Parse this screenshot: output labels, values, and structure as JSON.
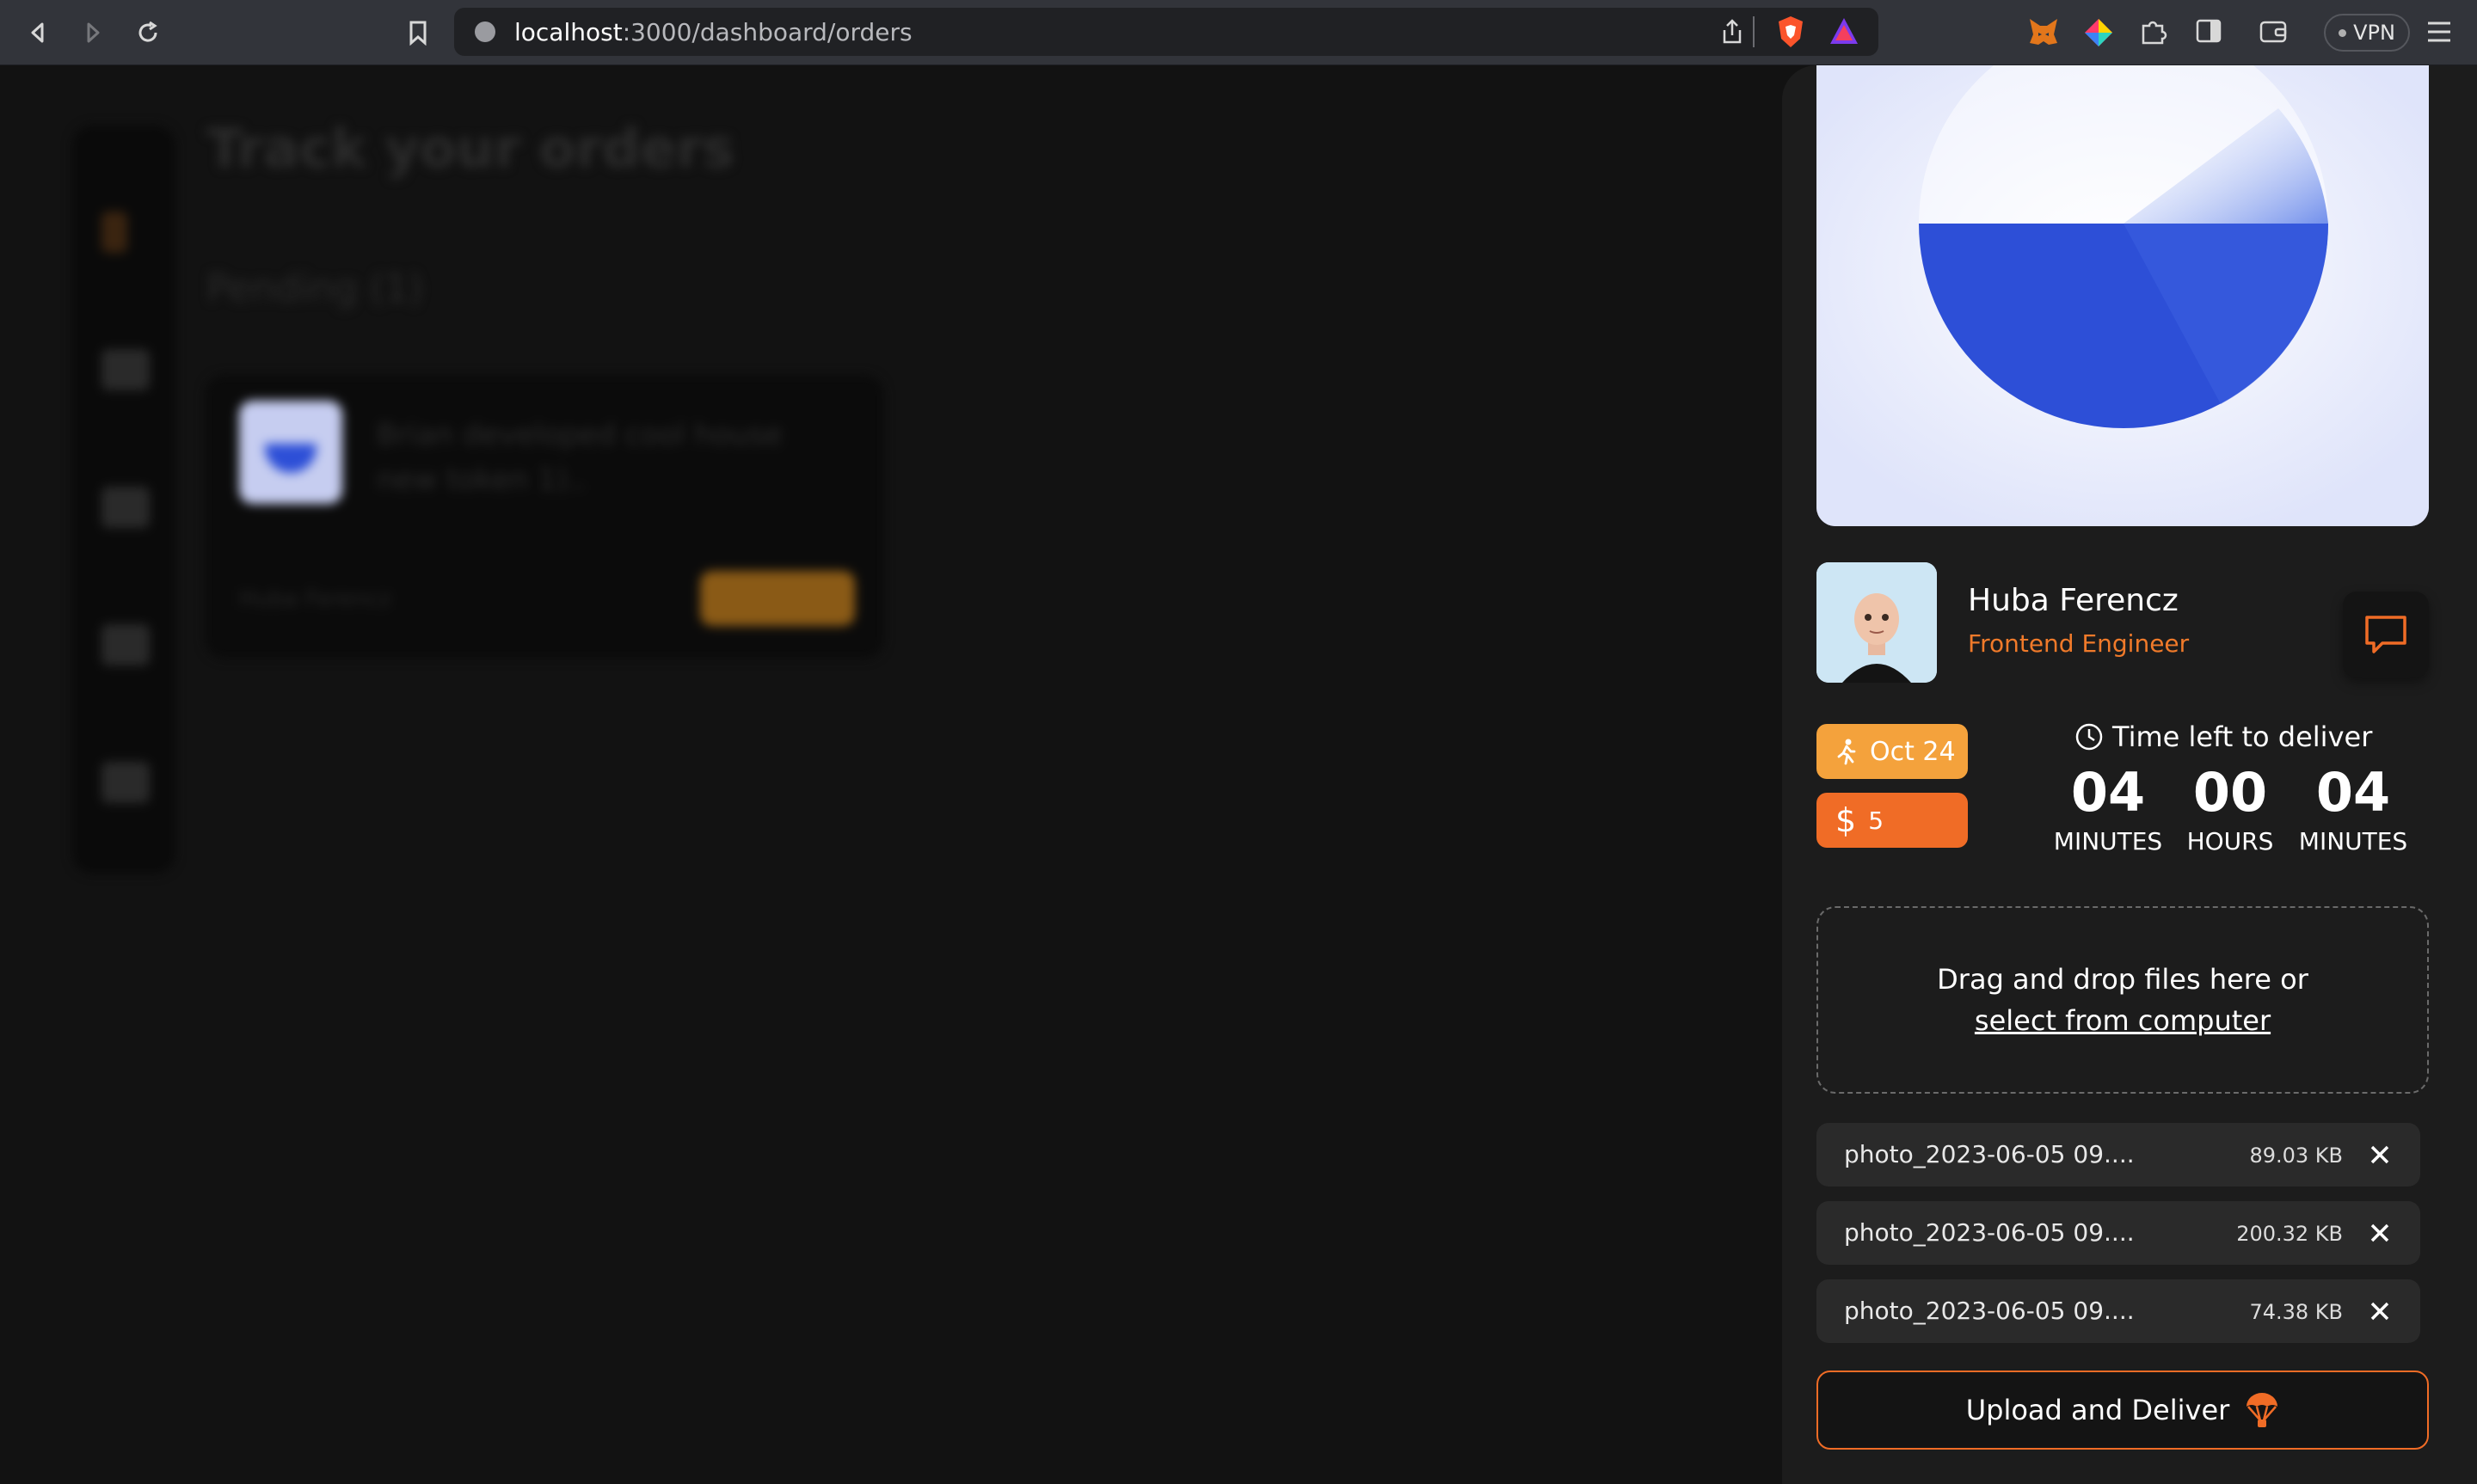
{
  "browser": {
    "url_host": "localhost",
    "url_path": ":3000/dashboard/orders",
    "vpn_label": "VPN",
    "icons": [
      "back-icon",
      "forward-icon",
      "reload-icon",
      "bookmark-icon",
      "share-icon",
      "brave-shield-icon",
      "brave-rewards-icon",
      "metamask-icon",
      "color-extension-icon",
      "extensions-icon",
      "sidebar-icon",
      "wallet-icon",
      "menu-icon"
    ]
  },
  "background": {
    "page_title": "Track your orders",
    "pending_heading": "Pending (1)",
    "card_text": "Brian developed cool house new token 1)..",
    "card_person": "Huba Ferencz"
  },
  "drawer": {
    "seller": {
      "name": "Huba Ferencz",
      "role": "Frontend Engineer"
    },
    "badges": {
      "date": "Oct 24",
      "price_symbol": "$",
      "price": "5"
    },
    "timer": {
      "title": "Time left to deliver",
      "blocks": [
        {
          "value": "04",
          "unit": "MINUTES"
        },
        {
          "value": "00",
          "unit": "HOURS"
        },
        {
          "value": "04",
          "unit": "MINUTES"
        }
      ]
    },
    "dropzone": {
      "line1": "Drag and drop files here or",
      "link": "select from computer"
    },
    "files": [
      {
        "name": "photo_2023-06-05 09....",
        "size": "89.03 KB"
      },
      {
        "name": "photo_2023-06-05 09....",
        "size": "200.32 KB"
      },
      {
        "name": "photo_2023-06-05 09....",
        "size": "74.38 KB"
      }
    ],
    "deliver_button": "Upload and Deliver"
  },
  "colors": {
    "accent_orange": "#f06c26",
    "accent_amber": "#f4a23c",
    "hero_blue": "#2d4fd7",
    "panel_bg": "#1c1c1c"
  }
}
